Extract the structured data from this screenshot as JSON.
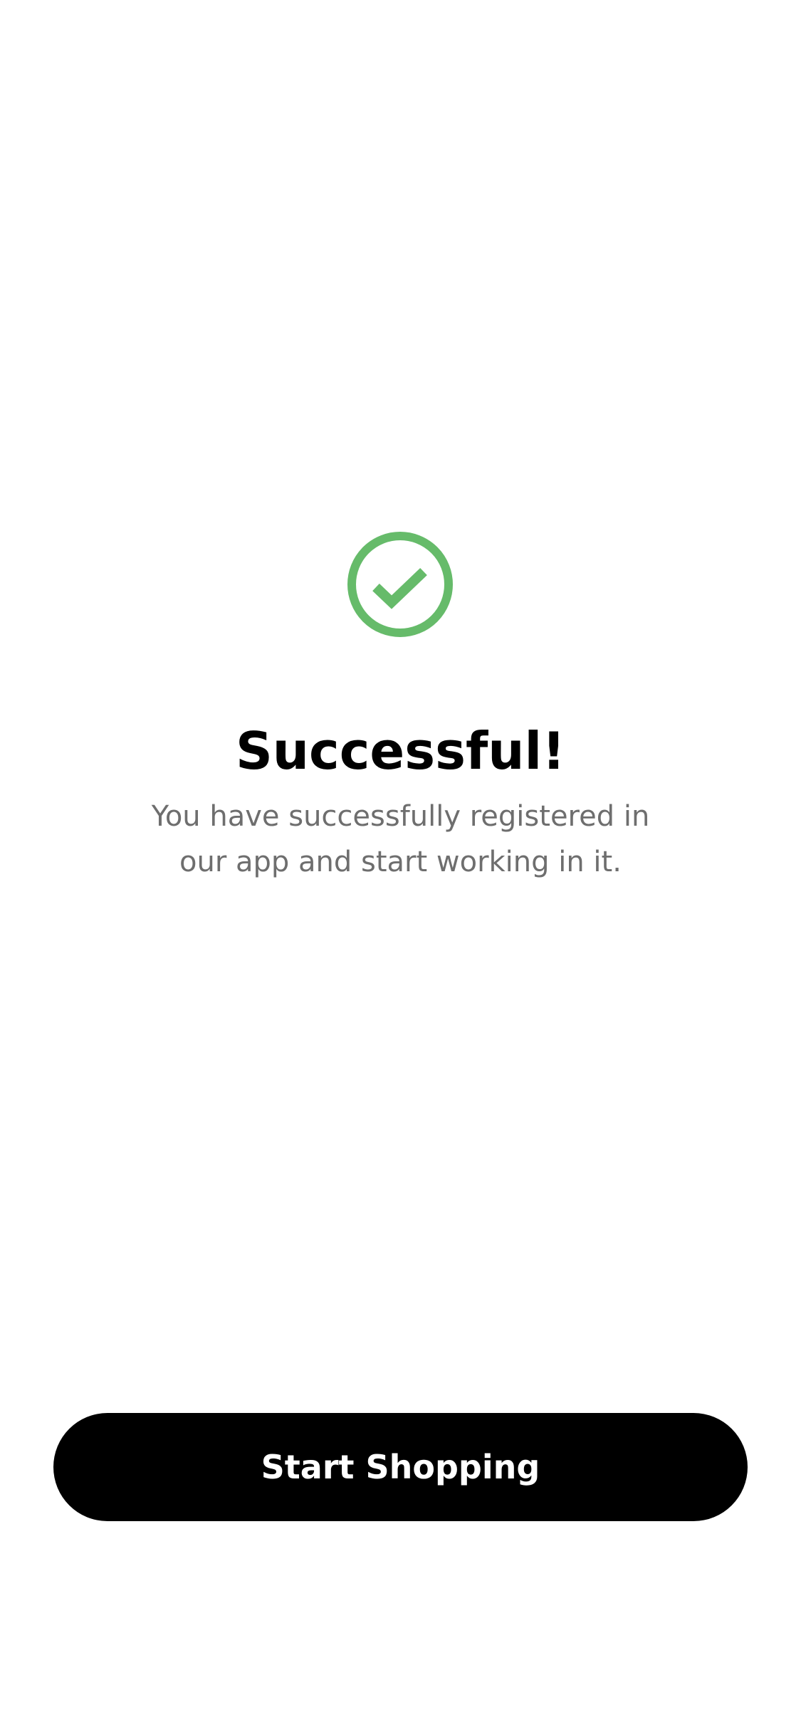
{
  "screen": {
    "icon": "check-circle-icon",
    "accent_color": "#66BB6A",
    "title": "Successful!",
    "message_lines": [
      "You have successfully registered in",
      "our app and start working in it."
    ]
  },
  "actions": {
    "primary_label": "Start Shopping",
    "primary_color": "#000000"
  }
}
